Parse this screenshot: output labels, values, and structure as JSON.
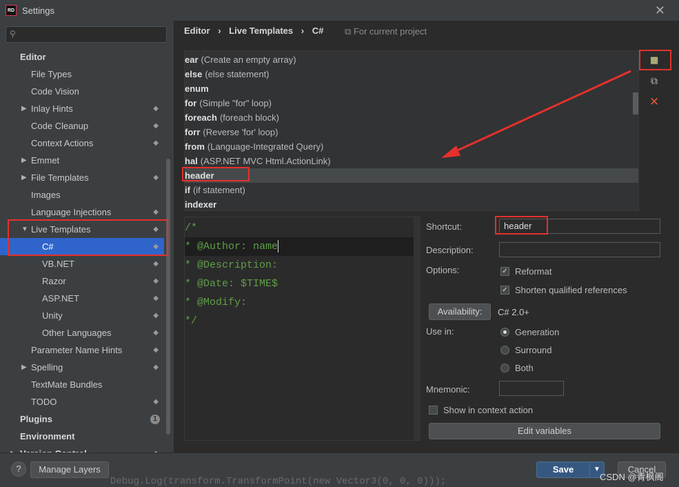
{
  "window": {
    "title": "Settings",
    "logo_text": "RD",
    "close_glyph": "✕"
  },
  "search": {
    "placeholder": ""
  },
  "sidebar": {
    "items": [
      {
        "label": "Editor",
        "bold": true,
        "indent": 0
      },
      {
        "label": "File Types",
        "indent": 2
      },
      {
        "label": "Code Vision",
        "indent": 2
      },
      {
        "label": "Inlay Hints",
        "indent": 2,
        "arrow": "▶",
        "trail": "◆"
      },
      {
        "label": "Code Cleanup",
        "indent": 2,
        "trail": "◆"
      },
      {
        "label": "Context Actions",
        "indent": 2,
        "trail": "◆"
      },
      {
        "label": "Emmet",
        "indent": 2,
        "arrow": "▶"
      },
      {
        "label": "File Templates",
        "indent": 2,
        "arrow": "▶",
        "trail": "◆"
      },
      {
        "label": "Images",
        "indent": 2
      },
      {
        "label": "Language Injections",
        "indent": 2,
        "trail": "◆"
      },
      {
        "label": "Live Templates",
        "indent": 2,
        "arrow": "▼",
        "trail": "◆"
      },
      {
        "label": "C#",
        "indent": 3,
        "trail": "◆",
        "selected": true
      },
      {
        "label": "VB.NET",
        "indent": 3,
        "trail": "◆"
      },
      {
        "label": "Razor",
        "indent": 3,
        "trail": "◆"
      },
      {
        "label": "ASP.NET",
        "indent": 3,
        "trail": "◆"
      },
      {
        "label": "Unity",
        "indent": 3,
        "trail": "◆"
      },
      {
        "label": "Other Languages",
        "indent": 3,
        "trail": "◆"
      },
      {
        "label": "Parameter Name Hints",
        "indent": 2,
        "trail": "◆"
      },
      {
        "label": "Spelling",
        "indent": 2,
        "arrow": "▶",
        "trail": "◆"
      },
      {
        "label": "TextMate Bundles",
        "indent": 2
      },
      {
        "label": "TODO",
        "indent": 2,
        "trail": "◆"
      },
      {
        "label": "Plugins",
        "bold": true,
        "indent": 0,
        "badge": "1"
      },
      {
        "label": "Environment",
        "bold": true,
        "indent": 0
      },
      {
        "label": "Version Control",
        "bold": true,
        "indent": 0,
        "arrow": "▶",
        "trail": "◆"
      }
    ]
  },
  "breadcrumb": {
    "part1": "Editor",
    "sep": "›",
    "part2": "Live Templates",
    "part3": "C#",
    "note": "For current project",
    "note_icon": "⧉"
  },
  "templates": [
    {
      "key": "ear",
      "desc": "(Create an empty array)"
    },
    {
      "key": "else",
      "desc": "(else statement)"
    },
    {
      "key": "enum",
      "desc": ""
    },
    {
      "key": "for",
      "desc": "(Simple \"for\" loop)"
    },
    {
      "key": "foreach",
      "desc": "(foreach block)"
    },
    {
      "key": "forr",
      "desc": "(Reverse 'for' loop)"
    },
    {
      "key": "from",
      "desc": "(Language-Integrated Query)"
    },
    {
      "key": "hal",
      "desc": "(ASP.NET MVC Html.ActionLink)"
    },
    {
      "key": "header",
      "desc": "",
      "selected": true
    },
    {
      "key": "if",
      "desc": "(if statement)"
    },
    {
      "key": "indexer",
      "desc": ""
    }
  ],
  "tools": {
    "add": "add-template-icon",
    "copy": "copy-icon",
    "remove": "remove-icon"
  },
  "editor": {
    "lines": [
      "/*",
      "* @Author: name",
      "* @Description:",
      "* @Date: $TIME$",
      "* @Modify:",
      "*/"
    ]
  },
  "props": {
    "shortcut_label": "Shortcut:",
    "shortcut_value": "header",
    "description_label": "Description:",
    "description_value": "",
    "options_label": "Options:",
    "reformat": "Reformat",
    "shorten": "Shorten qualified references",
    "availability_button": "Availability:",
    "availability_value": "C# 2.0+",
    "use_in_label": "Use in:",
    "generation": "Generation",
    "surround": "Surround",
    "both": "Both",
    "mnemonic_label": "Mnemonic:",
    "mnemonic_value": "",
    "show_context": "Show in context action",
    "edit_variables": "Edit variables"
  },
  "footer": {
    "help": "?",
    "manage_layers": "Manage Layers",
    "save": "Save",
    "cancel": "Cancel",
    "bg_code": "Debug.Log(transform.TransformPoint(new Vector3(0, 0, 0)));",
    "watermark": "CSDN @青枫阁"
  },
  "colors": {
    "accent": "#2f65ca",
    "annotation": "#e5302c",
    "code_comment": "#5f9e48",
    "save_button": "#365880"
  }
}
